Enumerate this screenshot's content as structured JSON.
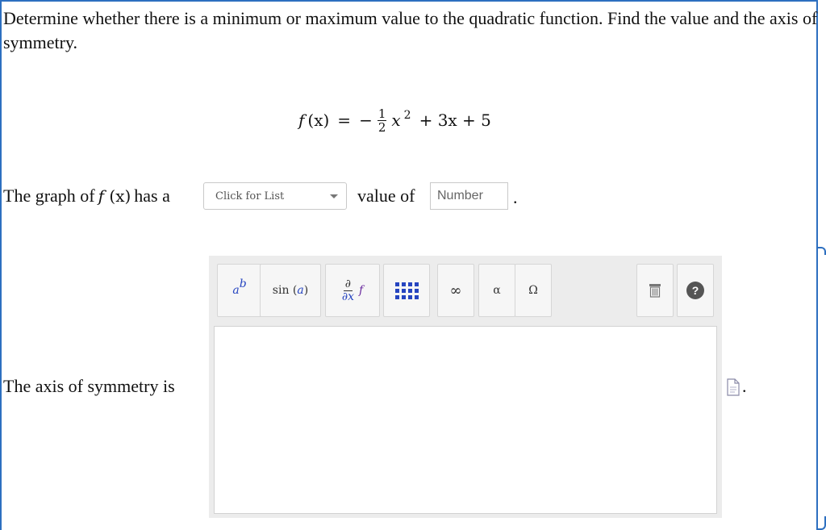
{
  "prompt": "Determine whether there is a minimum or maximum value to the quadratic function. Find the value and the axis of symmetry.",
  "formula": {
    "lhs_f": "f",
    "lhs_arg": "(x)",
    "equals": "=",
    "sign": "−",
    "frac_num": "1",
    "frac_den": "2",
    "x": "x",
    "exp": "2",
    "rest": "+ 3x + 5"
  },
  "line1": {
    "prefix": "The graph of",
    "fx_f": "f",
    "fx_arg": "(x)",
    "has_a": "has a",
    "select_value": "Click for List",
    "value_of": "value of",
    "number_placeholder": "Number",
    "period": "."
  },
  "line2": {
    "text": "The axis of symmetry is",
    "period": "."
  },
  "toolbar": {
    "power_base": "a",
    "power_exp": "b",
    "sin_label": "sin",
    "sin_arg": "a",
    "deriv_num": "∂",
    "deriv_den": "∂x",
    "deriv_f": "f",
    "infinity": "∞",
    "alpha": "α",
    "omega": "Ω",
    "help": "?"
  },
  "colors": {
    "frame_border": "#2d6fc0",
    "toolbar_bg": "#ececec",
    "variable_blue": "#2645c0",
    "function_purple": "#6a2a9e"
  },
  "icons": [
    "trash-icon",
    "help-icon",
    "matrix-icon",
    "file-icon"
  ]
}
